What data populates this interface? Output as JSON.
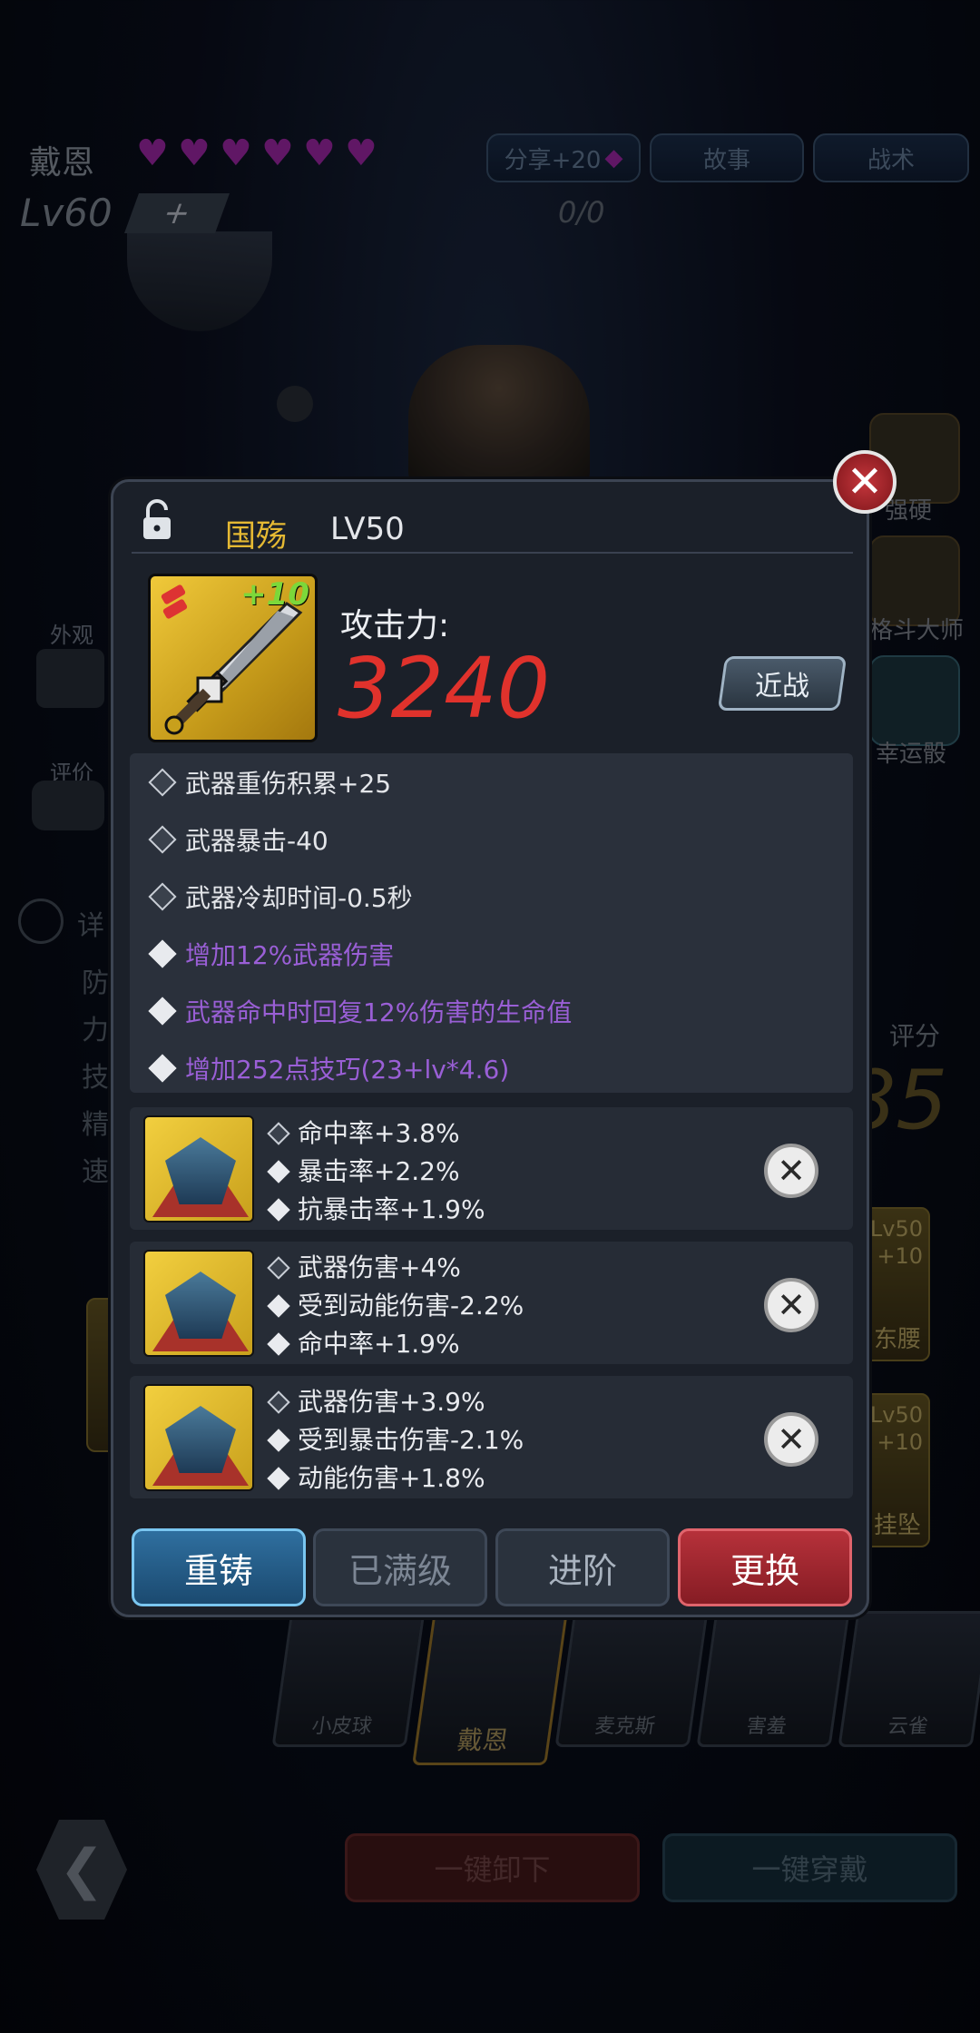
{
  "background": {
    "hero_name": "戴恩",
    "hearts": 6,
    "top_buttons": [
      "分享+20",
      "故事",
      "战术"
    ],
    "level": "Lv60",
    "plus": "+",
    "exp": "0/0",
    "left_labels": [
      "外观",
      "评价"
    ],
    "detail_label": "详",
    "stat_rows": [
      "防",
      "力",
      "技",
      "精",
      "速"
    ],
    "right_skills": [
      "强硬",
      "格斗大师",
      "幸运骰"
    ],
    "score_label": "评分",
    "score_value": "85",
    "side_cards": [
      "东腰",
      "挂坠"
    ],
    "side_card_levels": [
      "Lv50",
      "Lv50"
    ],
    "side_card_plus": [
      "+10",
      "+10"
    ],
    "portraits": [
      "小皮球",
      "戴恩",
      "麦克斯",
      "害羞",
      "云雀"
    ],
    "back_icon": "❮",
    "bottom_buttons": [
      "一键卸下",
      "一键穿戴"
    ]
  },
  "modal": {
    "close_icon": "✕",
    "item_name": "国殇",
    "item_level": "LV50",
    "enhance": "+10",
    "attack_label": "攻击力:",
    "attack_value": "3240",
    "type_button": "近战",
    "attributes": [
      {
        "text": "武器重伤积累+25",
        "color": "#e4e6ea",
        "style": "lock"
      },
      {
        "text": "武器暴击-40",
        "color": "#e4e6ea",
        "style": "lock"
      },
      {
        "text": "武器冷却时间-0.5秒",
        "color": "#e4e6ea",
        "style": "lock"
      },
      {
        "text": "增加12%武器伤害",
        "color": "#9a5fd6",
        "style": "solid"
      },
      {
        "text": "武器命中时回复12%伤害的生命值",
        "color": "#9a5fd6",
        "style": "solid"
      },
      {
        "text": "增加252点技巧(23+lv*4.6)",
        "color": "#9a5fd6",
        "style": "solid"
      }
    ],
    "gems": [
      {
        "lines": [
          [
            "lock",
            "命中率+3.8%"
          ],
          [
            "solid",
            "暴击率+2.2%"
          ],
          [
            "solid",
            "抗暴击率+1.9%"
          ]
        ]
      },
      {
        "lines": [
          [
            "lock",
            "武器伤害+4%"
          ],
          [
            "solid",
            "受到动能伤害-2.2%"
          ],
          [
            "solid",
            "命中率+1.9%"
          ]
        ]
      },
      {
        "lines": [
          [
            "lock",
            "武器伤害+3.9%"
          ],
          [
            "solid",
            "受到暴击伤害-2.1%"
          ],
          [
            "solid",
            "动能伤害+1.8%"
          ]
        ]
      }
    ],
    "remove_icon": "✕",
    "actions": [
      "重铸",
      "已满级",
      "进阶",
      "更换"
    ]
  },
  "colors": {
    "gold": "#e5b933",
    "attack_red": "#e0322c",
    "purple_attr": "#9a5fd6",
    "recast_blue": "#2a6a9a",
    "replace_red": "#a8262c"
  }
}
